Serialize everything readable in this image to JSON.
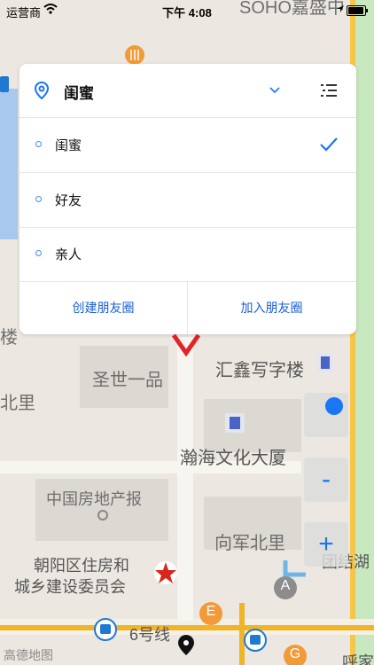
{
  "status_bar": {
    "carrier": "运营商",
    "time": "下午 4:08"
  },
  "group_panel": {
    "selected_group": "闺蜜",
    "groups": [
      {
        "label": "闺蜜",
        "selected": true
      },
      {
        "label": "好友",
        "selected": false
      },
      {
        "label": "亲人",
        "selected": false
      }
    ],
    "create_label": "创建朋友圈",
    "join_label": "加入朋友圈",
    "accent_color": "#1976f5"
  },
  "map_controls": {
    "zoom_out_label": "-",
    "zoom_in_label": "+"
  },
  "map": {
    "labels": {
      "soho": "SOHO嘉盛中",
      "shengshi": "圣世一品",
      "huixin": "汇鑫写字楼",
      "beili": "北里",
      "lou": "楼",
      "hanhai": "瀚海文化大厦",
      "china_realestate": "中国房地产报",
      "xiangjun": "向军北里",
      "chaoyang_1": "朝阳区住房和",
      "chaoyang_2": "城乡建设委员会",
      "line6": "6号线",
      "tuanjiehu": "团结湖",
      "gaode": "高德地图",
      "hu": "呼家"
    },
    "marker_letters": {
      "a": "A",
      "e": "E",
      "g": "G"
    }
  }
}
